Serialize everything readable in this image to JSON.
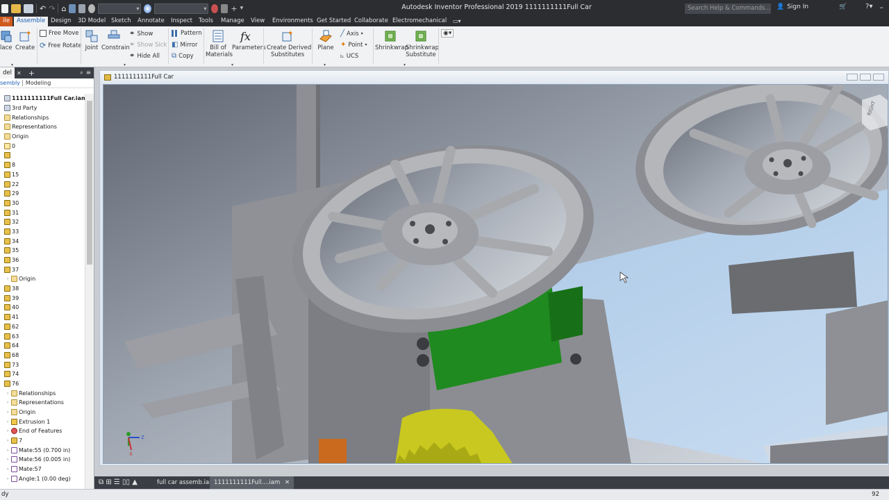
{
  "titlebar": {
    "app_title": "Autodesk Inventor Professional 2019     1111111111Full Car",
    "search_placeholder": "Search Help & Commands...",
    "sign_in": "Sign In"
  },
  "tabs": [
    {
      "label": "ile",
      "state": "file"
    },
    {
      "label": "Assemble",
      "state": "active"
    },
    {
      "label": "Design"
    },
    {
      "label": "3D Model"
    },
    {
      "label": "Sketch"
    },
    {
      "label": "Annotate"
    },
    {
      "label": "Inspect"
    },
    {
      "label": "Tools"
    },
    {
      "label": "Manage"
    },
    {
      "label": "View"
    },
    {
      "label": "Environments"
    },
    {
      "label": "Get Started"
    },
    {
      "label": "Collaborate"
    },
    {
      "label": "Electromechanical"
    }
  ],
  "ribbon": {
    "place": "lace",
    "create": "Create",
    "free_move": "Free Move",
    "free_rotate": "Free Rotate",
    "joint": "Joint",
    "constrain": "Constrain",
    "show": "Show",
    "show_sick": "Show Sick",
    "hide_all": "Hide All",
    "pattern": "Pattern",
    "mirror": "Mirror",
    "copy": "Copy",
    "bill_of_materials": [
      "Bill of",
      "Materials"
    ],
    "parameters": "Parameters",
    "create_derived": [
      "Create Derived",
      "Substitutes"
    ],
    "plane": "Plane",
    "axis": "Axis",
    "point": "Point",
    "ucs": "UCS",
    "shrinkwrap": "Shrinkwrap",
    "shrinkwrap_sub": [
      "Shrinkwrap",
      "Substitute"
    ]
  },
  "browser": {
    "tab_label": "del",
    "sub_assembly": "sembly",
    "sub_modeling": "Modeling",
    "tree": [
      {
        "label": "1111111111Full Car.iam",
        "icon": "asm",
        "level": 0,
        "root": true
      },
      {
        "label": "3rd Party",
        "icon": "asm",
        "level": 0
      },
      {
        "label": "Relationships",
        "icon": "folder",
        "level": 0
      },
      {
        "label": "Representations",
        "icon": "folder",
        "level": 0
      },
      {
        "label": "Origin",
        "icon": "folder",
        "level": 0
      },
      {
        "label": "0",
        "icon": "origin",
        "level": 0
      },
      {
        "label": "",
        "icon": "part",
        "level": 0
      },
      {
        "label": "8",
        "icon": "part",
        "level": 0
      },
      {
        "label": "15",
        "icon": "part",
        "level": 0
      },
      {
        "label": "22",
        "icon": "part",
        "level": 0
      },
      {
        "label": "29",
        "icon": "part",
        "level": 0
      },
      {
        "label": "30",
        "icon": "part",
        "level": 0
      },
      {
        "label": "31",
        "icon": "part",
        "level": 0
      },
      {
        "label": "32",
        "icon": "part",
        "level": 0
      },
      {
        "label": "33",
        "icon": "part",
        "level": 0
      },
      {
        "label": "34",
        "icon": "part",
        "level": 0
      },
      {
        "label": "35",
        "icon": "part",
        "level": 0
      },
      {
        "label": "36",
        "icon": "part",
        "level": 0
      },
      {
        "label": "37",
        "icon": "part",
        "level": 0
      },
      {
        "label": "Origin",
        "icon": "folder",
        "level": 1
      },
      {
        "label": "38",
        "icon": "part",
        "level": 0
      },
      {
        "label": "39",
        "icon": "part",
        "level": 0
      },
      {
        "label": "40",
        "icon": "part",
        "level": 0
      },
      {
        "label": "41",
        "icon": "part",
        "level": 0
      },
      {
        "label": "62",
        "icon": "part",
        "level": 0
      },
      {
        "label": "63",
        "icon": "part",
        "level": 0
      },
      {
        "label": "64",
        "icon": "part",
        "level": 0
      },
      {
        "label": "68",
        "icon": "part",
        "level": 0
      },
      {
        "label": "73",
        "icon": "part",
        "level": 0
      },
      {
        "label": "74",
        "icon": "part",
        "level": 0
      },
      {
        "label": "76",
        "icon": "part",
        "level": 0
      },
      {
        "label": "Relationships",
        "icon": "folder",
        "level": 1
      },
      {
        "label": "Representations",
        "icon": "folder",
        "level": 1
      },
      {
        "label": "Origin",
        "icon": "folder",
        "level": 1
      },
      {
        "label": "Extrusion 1",
        "icon": "ext",
        "level": 1
      },
      {
        "label": "End of Features",
        "icon": "feat",
        "level": 1
      },
      {
        "label": "7",
        "icon": "part",
        "level": 1
      },
      {
        "label": "Mate:55 (0.700 in)",
        "icon": "mate",
        "level": 1
      },
      {
        "label": "Mate:56 (0.005 in)",
        "icon": "mate",
        "level": 1
      },
      {
        "label": "Mate:57",
        "icon": "mate",
        "level": 1
      },
      {
        "label": "Angle:1 (0.00 deg)",
        "icon": "mate",
        "level": 1
      }
    ]
  },
  "document": {
    "title": "1111111111Full Car"
  },
  "doc_tabs": [
    {
      "label": "full car assemb.iam",
      "active": false
    },
    {
      "label": "1111111111Full....iam",
      "active": true
    }
  ],
  "status": {
    "left": "dy",
    "right": "92"
  },
  "colors": {
    "file_tab": "#d05b1f",
    "active_tab_text": "#1a5fb4",
    "wheel_gray": "#9a9a9d",
    "servo_green": "#1f8a1f",
    "gear_yellow": "#c8c820",
    "plate_blue": "#b9d3ec"
  }
}
